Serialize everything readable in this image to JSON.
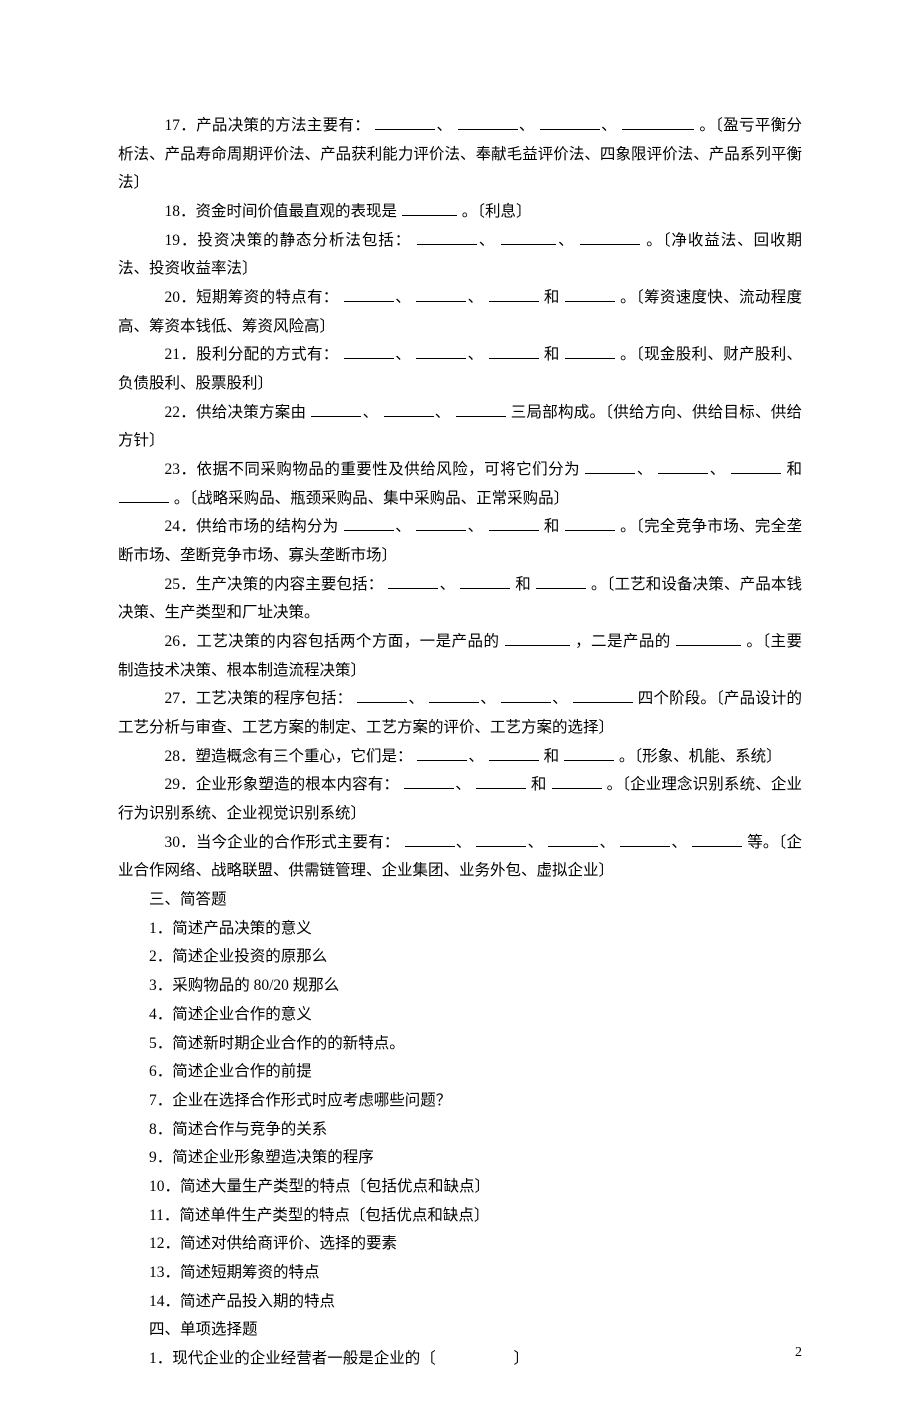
{
  "fill": {
    "q17a": "17．产品决策的方法主要有：",
    "q17b": "。〔盈亏平衡分析法、产品寿命周期评价法、产品获利能力评价法、奉献毛益评价法、四象限评价法、产品系列平衡法〕",
    "q18a": "18．资金时间价值最直观的表现是",
    "q18b": "。〔利息〕",
    "q19a": "19．投资决策的静态分析法包括：",
    "q19b": "。〔净收益法、回收期法、投资收益率法〕",
    "q20a": "20．短期筹资的特点有：",
    "q20b": "和",
    "q20c": "。〔筹资速度快、流动程度高、筹资本钱低、筹资风险高〕",
    "q21a": "21．股利分配的方式有：",
    "q21b": "和",
    "q21c": "。〔现金股利、财产股利、负债股利、股票股利〕",
    "q22a": "22．供给决策方案由",
    "q22b": "三局部构成。〔供给方向、供给目标、供给方针〕",
    "q23a": "23．依据不同采购物品的重要性及供给风险，可将它们分为",
    "q23b": "和",
    "q23c": "。〔战略采购品、瓶颈采购品、集中采购品、正常采购品〕",
    "q24a": "24．供给市场的结构分为",
    "q24b": "和",
    "q24c": "。〔完全竞争市场、完全垄断市场、垄断竞争市场、寡头垄断市场〕",
    "q25a": "25．生产决策的内容主要包括：",
    "q25b": "和",
    "q25c": "。〔工艺和设备决策、产品本钱决策、生产类型和厂址决策。",
    "q26a": "26．工艺决策的内容包括两个方面，一是产品的",
    "q26b": "，二是产品的",
    "q26c": "。〔主要制造技术决策、根本制造流程决策〕",
    "q27a": "27．工艺决策的程序包括：",
    "q27b": "四个阶段。〔产品设计的工艺分析与审查、工艺方案的制定、工艺方案的评价、工艺方案的选择〕",
    "q28a": "28．塑造概念有三个重心，它们是：",
    "q28b": "和",
    "q28c": "。〔形象、机能、系统〕",
    "q29a": "29．企业形象塑造的根本内容有：",
    "q29b": "和",
    "q29c": "。〔企业理念识别系统、企业行为识别系统、企业视觉识别系统〕",
    "q30a": "30．当今企业的合作形式主要有：",
    "q30b": "等。〔企业合作网络、战略联盟、供需链管理、企业集团、业务外包、虚拟企业〕"
  },
  "sep": "、",
  "section3": "三、简答题",
  "sa": [
    "1．简述产品决策的意义",
    "2．简述企业投资的原那么",
    "3．采购物品的 80/20 规那么",
    "4．简述企业合作的意义",
    "5．简述新时期企业合作的的新特点。",
    "6．简述企业合作的前提",
    "7．企业在选择合作形式时应考虑哪些问题？",
    "8．简述合作与竞争的关系",
    "9．简述企业形象塑造决策的程序",
    "10．简述大量生产类型的特点〔包括优点和缺点〕",
    "11．简述单件生产类型的特点〔包括优点和缺点〕",
    "12．简述对供给商评价、选择的要素",
    "13．简述短期筹资的特点",
    "14．简述产品投入期的特点"
  ],
  "section4": "四、单项选择题",
  "mc1a": "1．现代企业的企业经营者一般是企业的〔",
  "mc1b": "〕",
  "pagenum": "2"
}
